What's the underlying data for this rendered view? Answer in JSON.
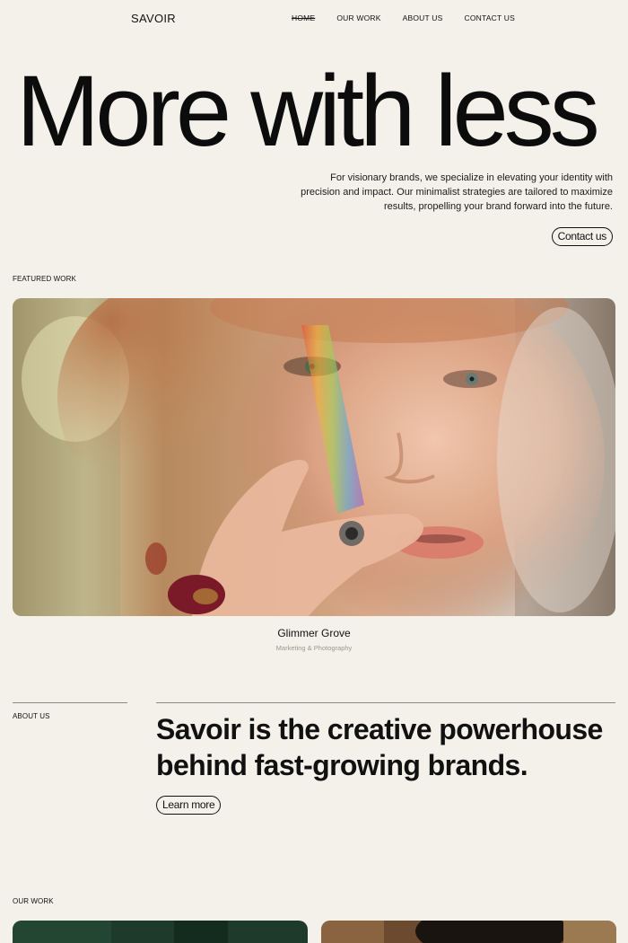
{
  "nav": {
    "logo": "SAVOIR",
    "links": [
      "HOME",
      "OUR WORK",
      "ABOUT US",
      "CONTACT US"
    ]
  },
  "hero": {
    "title": "More with less",
    "description": "For visionary brands, we specialize in elevating your identity with precision and impact. Our minimalist strategies are tailored to maximize results, propelling your brand forward into the future.",
    "contact_label": "Contact us"
  },
  "featured": {
    "section_label": "FEATURED WORK",
    "title": "Glimmer Grove",
    "subtitle": "Marketing & Photography"
  },
  "about": {
    "section_label": "ABOUT US",
    "headline": "Savoir is the creative powerhouse behind fast-growing brands.",
    "learn_more_label": "Learn more"
  },
  "our_work": {
    "section_label": "OUR WORK"
  },
  "colors": {
    "background": "#f4f1ea",
    "text": "#111111",
    "muted": "#9a978f"
  }
}
